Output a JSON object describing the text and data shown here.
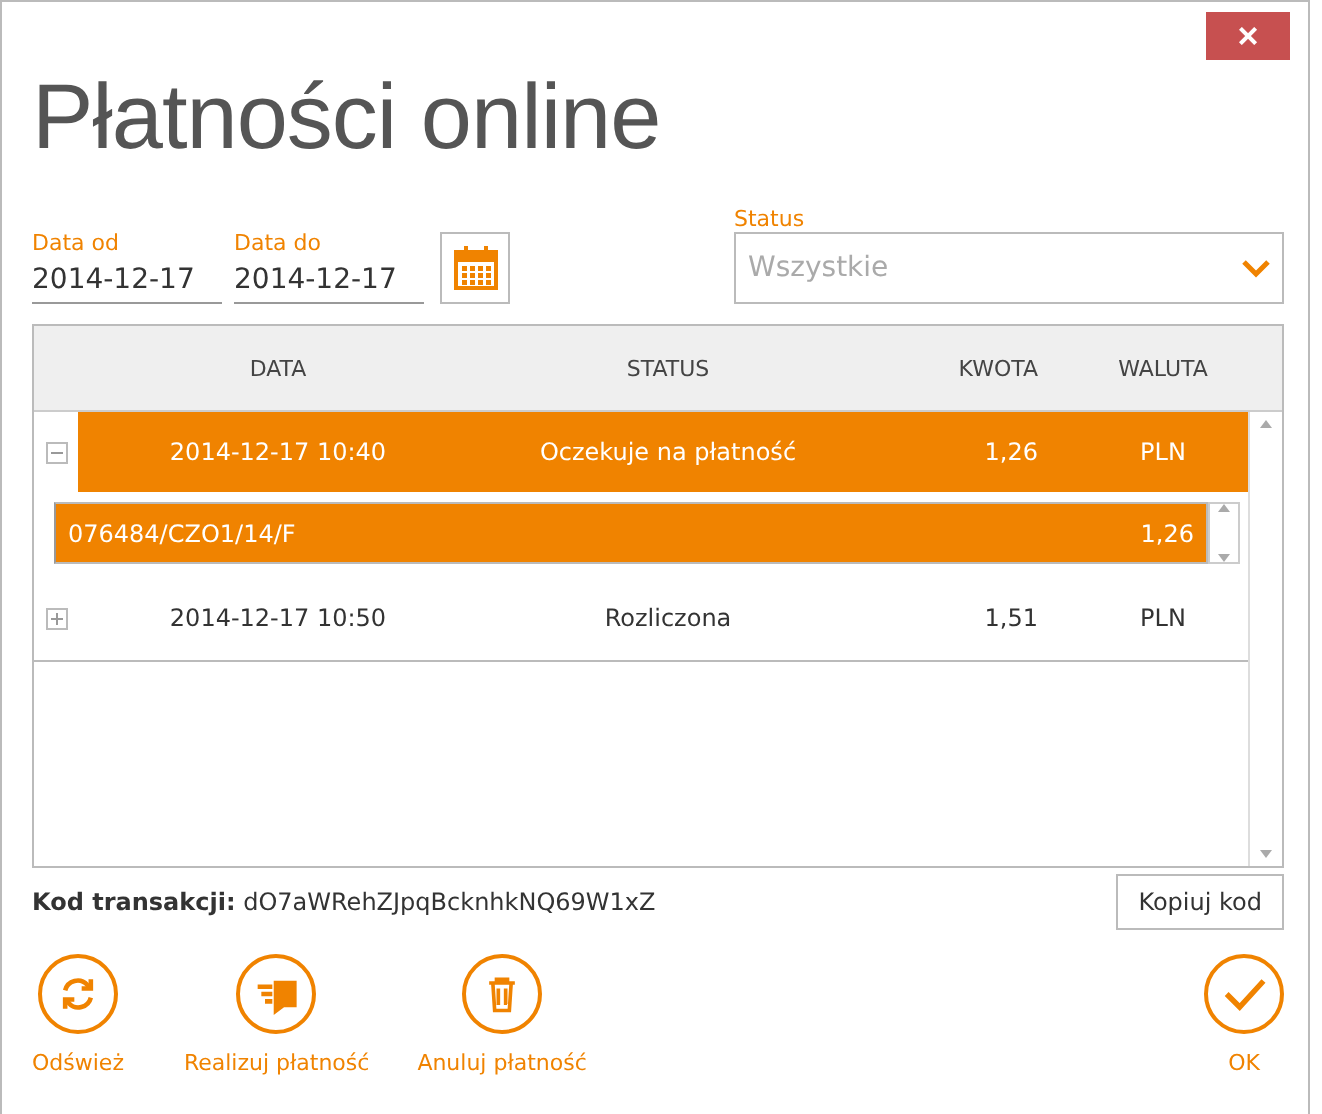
{
  "window": {
    "title": "Płatności online",
    "close": "×"
  },
  "filters": {
    "date_from": {
      "label": "Data od",
      "value": "2014-12-17"
    },
    "date_to": {
      "label": "Data do",
      "value": "2014-12-17"
    },
    "status": {
      "label": "Status",
      "placeholder": "Wszystkie"
    }
  },
  "table": {
    "columns": [
      "DATA",
      "STATUS",
      "KWOTA",
      "WALUTA"
    ],
    "rows": [
      {
        "date": "2014-12-17 10:40",
        "status": "Oczekuje na płatność",
        "amount": "1,26",
        "currency": "PLN",
        "selected": true,
        "expanded": true,
        "details": [
          {
            "reference": "076484/CZO1/14/F",
            "amount": "1,26",
            "selected": true
          }
        ]
      },
      {
        "date": "2014-12-17 10:50",
        "status": "Rozliczona",
        "amount": "1,51",
        "currency": "PLN",
        "selected": false,
        "expanded": false,
        "details": []
      }
    ]
  },
  "transaction": {
    "label": "Kod transakcji:",
    "code": "dO7aWRehZJpqBcknhkNQ69W1xZ",
    "copy_button": "Kopiuj kod"
  },
  "actions": [
    {
      "kind": "refresh",
      "label": "Odśwież"
    },
    {
      "kind": "pay",
      "label": "Realizuj płatność"
    },
    {
      "kind": "cancel",
      "label": "Anuluj płatność"
    }
  ],
  "ok": {
    "kind": "ok",
    "label": "OK"
  }
}
